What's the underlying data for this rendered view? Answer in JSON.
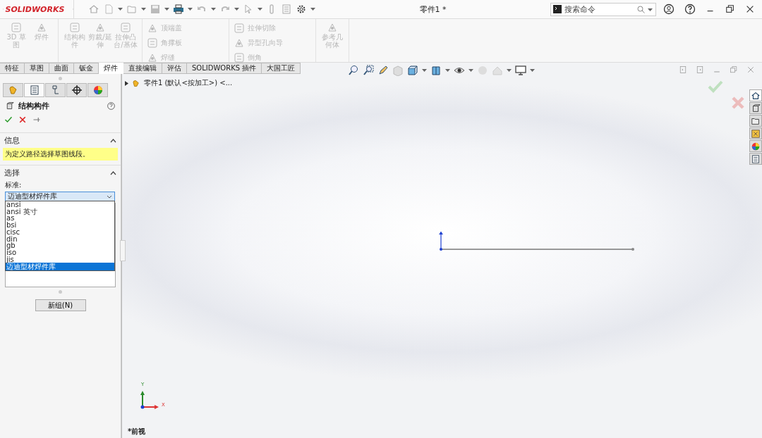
{
  "title_bar": {
    "logo": "SOLIDWORKS",
    "document_title": "零件1 *",
    "search": {
      "placeholder": "搜索命令"
    }
  },
  "ribbon": {
    "groups": [
      {
        "kind": "large",
        "items": [
          {
            "label": "3D 草图",
            "disabled": true
          },
          {
            "label": "焊件",
            "disabled": true
          }
        ]
      },
      {
        "kind": "large",
        "items": [
          {
            "label": "结构构件",
            "disabled": true
          },
          {
            "label": "剪裁/延伸",
            "disabled": true
          },
          {
            "label": "拉伸凸台/基体",
            "disabled": true
          }
        ]
      },
      {
        "kind": "small",
        "items": [
          {
            "label": "顶端盖",
            "disabled": true
          },
          {
            "label": "角撑板",
            "disabled": true
          },
          {
            "label": "焊缝",
            "disabled": true
          }
        ]
      },
      {
        "kind": "small",
        "items": [
          {
            "label": "拉伸切除",
            "disabled": true
          },
          {
            "label": "异型孔向导",
            "disabled": true
          },
          {
            "label": "倒角",
            "disabled": true
          }
        ]
      },
      {
        "kind": "large",
        "items": [
          {
            "label": "参考几何体",
            "disabled": true
          }
        ]
      }
    ]
  },
  "tabs": [
    {
      "label": "特征",
      "selected": false
    },
    {
      "label": "草图",
      "selected": false
    },
    {
      "label": "曲面",
      "selected": false
    },
    {
      "label": "钣金",
      "selected": false
    },
    {
      "label": "焊件",
      "selected": true
    },
    {
      "label": "直接编辑",
      "selected": false
    },
    {
      "label": "评估",
      "selected": false
    },
    {
      "label": "SOLIDWORKS 插件",
      "selected": false
    },
    {
      "label": "大国工匠",
      "selected": false
    }
  ],
  "panel_tabs": [
    {
      "selected": false
    },
    {
      "selected": true
    },
    {
      "selected": false
    },
    {
      "selected": false
    },
    {
      "selected": false
    }
  ],
  "property_manager": {
    "title": "结构构件",
    "sections": [
      {
        "title": "信息",
        "expanded": true,
        "message": "为定义路径选择草图线段。"
      },
      {
        "title": "选择",
        "expanded": true,
        "field_label": "标准:"
      }
    ],
    "standard_dropdown": {
      "value": "迈迪型材焊件库",
      "expanded": true,
      "options": [
        {
          "label": "ansi",
          "selected": false
        },
        {
          "label": "ansi 英寸",
          "selected": false
        },
        {
          "label": "as",
          "selected": false
        },
        {
          "label": "bsi",
          "selected": false
        },
        {
          "label": "cisc",
          "selected": false
        },
        {
          "label": "din",
          "selected": false
        },
        {
          "label": "gb",
          "selected": false
        },
        {
          "label": "iso",
          "selected": false
        },
        {
          "label": "jis",
          "selected": false
        },
        {
          "label": "迈迪型材焊件库",
          "selected": true
        }
      ]
    },
    "new_group_button": "新组(N)"
  },
  "viewport": {
    "tree_item": "零件1 (默认<按加工>) <...",
    "axis_labels": [
      "Y",
      "X"
    ],
    "view_name": "*前视"
  },
  "task_pane": [
    {
      "selected": true
    },
    {
      "selected": false
    },
    {
      "selected": false
    },
    {
      "selected": false
    },
    {
      "selected": false
    },
    {
      "selected": false
    }
  ]
}
